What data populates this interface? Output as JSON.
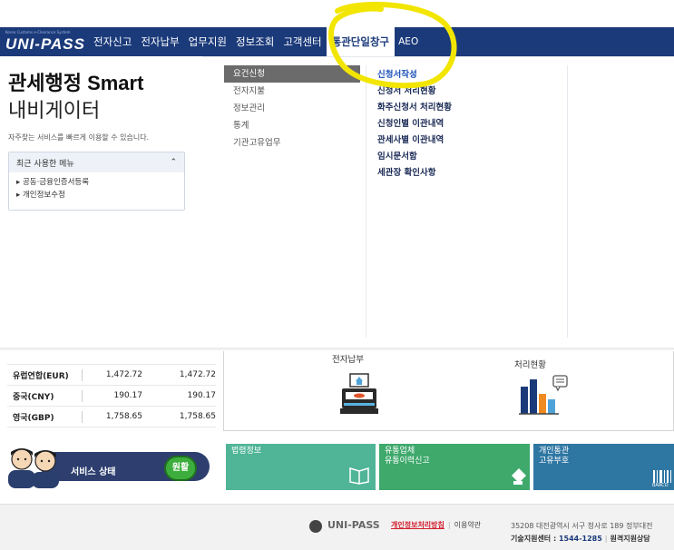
{
  "header": {
    "logo_sub": "Korea Customs e-Clearance System",
    "logo": "UNI-PASS",
    "nav": [
      "전자신고",
      "전자납부",
      "업무지원",
      "정보조회",
      "고객센터",
      "통관단일창구",
      "AEO"
    ]
  },
  "left": {
    "title": "관세행정 Smart",
    "subtitle": "내비게이터",
    "desc": "자주찾는 서비스를 빠르게 이용할 수 있습니다.",
    "recent_title": "최근 사용한 메뉴",
    "recent_items": [
      "▸ 공동·금융인증서등록",
      "▸ 개인정보수정"
    ]
  },
  "menu": {
    "level2": [
      "요건신청",
      "전자지불",
      "정보관리",
      "통계",
      "기관고유업무"
    ],
    "level3": [
      "신청서작성",
      "신청서 처리현황",
      "화주신청서 처리현황",
      "신청인별 이관내역",
      "관세사별 이관내역",
      "임시문서함",
      "세관장 확인사항"
    ]
  },
  "rates": [
    {
      "name": "유럽연합(EUR)",
      "v1": "1,472.72",
      "v2": "1,472.72"
    },
    {
      "name": "중국(CNY)",
      "v1": "190.17",
      "v2": "190.17"
    },
    {
      "name": "영국(GBP)",
      "v1": "1,758.65",
      "v2": "1,758.65"
    }
  ],
  "services": {
    "payment": "전자납부",
    "status_line": "처리현황"
  },
  "status": {
    "label": "서비스 상태",
    "value": "원활"
  },
  "tiles": {
    "t1": "법령정보",
    "t2_line1": "유통업체",
    "t2_line2": "유통이력신고",
    "t3_line1": "개인통관",
    "t3_line2": "고유부호",
    "t3_tag": "BARCO"
  },
  "footer": {
    "brand": "UNI-PASS",
    "privacy": "개인정보처리방침",
    "terms": "이용약관",
    "address": "35208 대전광역시 서구 청사로 189 정부대전",
    "help_label": "기술지원센터 : ",
    "help_num": "1544-1285",
    "remote": "원격지원상담"
  },
  "colors": {
    "header_bg": "#1b3a7a",
    "highlight": "#f2e500",
    "status_ok": "#3dae3d"
  }
}
